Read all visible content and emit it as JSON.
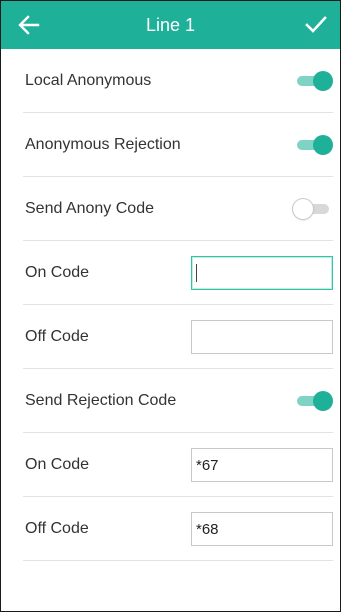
{
  "header": {
    "title": "Line 1",
    "back_icon": "arrow-left-icon",
    "confirm_icon": "checkmark-icon",
    "background_color": "#1fb09a"
  },
  "settings": {
    "local_anonymous": {
      "label": "Local Anonymous",
      "enabled": true
    },
    "anonymous_rejection": {
      "label": "Anonymous Rejection",
      "enabled": true
    },
    "send_anony_code": {
      "label": "Send Anony Code",
      "enabled": false
    },
    "anony_on_code": {
      "label": "On Code",
      "value": ""
    },
    "anony_off_code": {
      "label": "Off Code",
      "value": ""
    },
    "send_rejection_code": {
      "label": "Send Rejection Code",
      "enabled": true
    },
    "rejection_on_code": {
      "label": "On Code",
      "value": "*67"
    },
    "rejection_off_code": {
      "label": "Off Code",
      "value": "*68"
    }
  },
  "colors": {
    "accent": "#1fb09a",
    "toggle_on_track": "#7ed3c5",
    "toggle_off_track": "#d8d8d8",
    "focus_border": "#35c2ab"
  }
}
